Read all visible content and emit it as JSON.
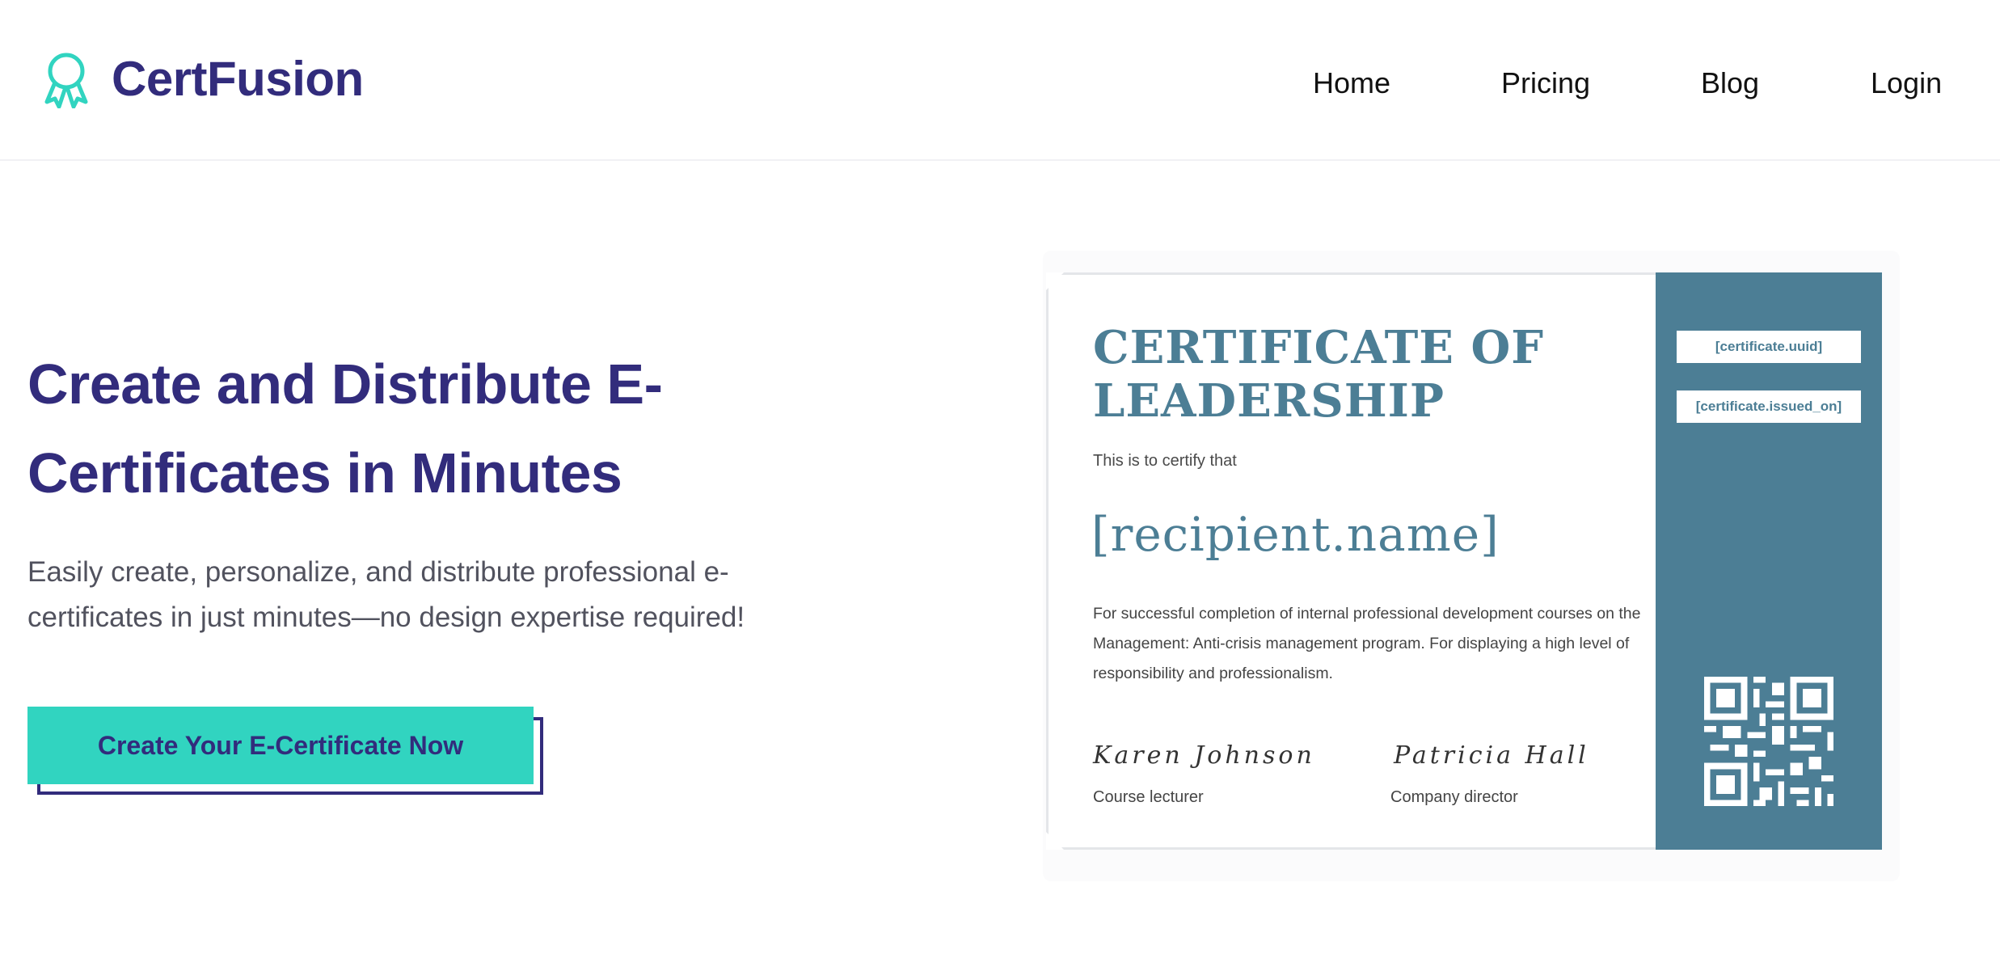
{
  "header": {
    "brand": "CertFusion",
    "nav": [
      "Home",
      "Pricing",
      "Blog",
      "Login"
    ]
  },
  "hero": {
    "title": "Create and Distribute E-Certificates in Minutes",
    "subtitle": "Easily create, personalize, and distribute professional e-certificates in just minutes—no design expertise required!",
    "cta_label": "Create Your E-Certificate Now"
  },
  "certificate": {
    "title": "CERTIFICATE OF LEADERSHIP",
    "intro": "This is to certify that",
    "recipient": "[recipient.name]",
    "body": "For successful completion of internal professional development courses on the Management: Anti-crisis management program. For displaying a high level of responsibility and professionalism.",
    "signatures": [
      {
        "name": "Karen Johnson",
        "role": "Course lecturer"
      },
      {
        "name": "Patricia Hall",
        "role": "Company director"
      }
    ],
    "fields": [
      "[certificate.uuid]",
      "[certificate.issued_on]"
    ]
  },
  "colors": {
    "brand": "#322c7c",
    "accent": "#31d4c0",
    "certificate": "#4c7e95"
  },
  "icons": {
    "logo": "award-ribbon-icon",
    "qr": "qr-code-icon"
  }
}
